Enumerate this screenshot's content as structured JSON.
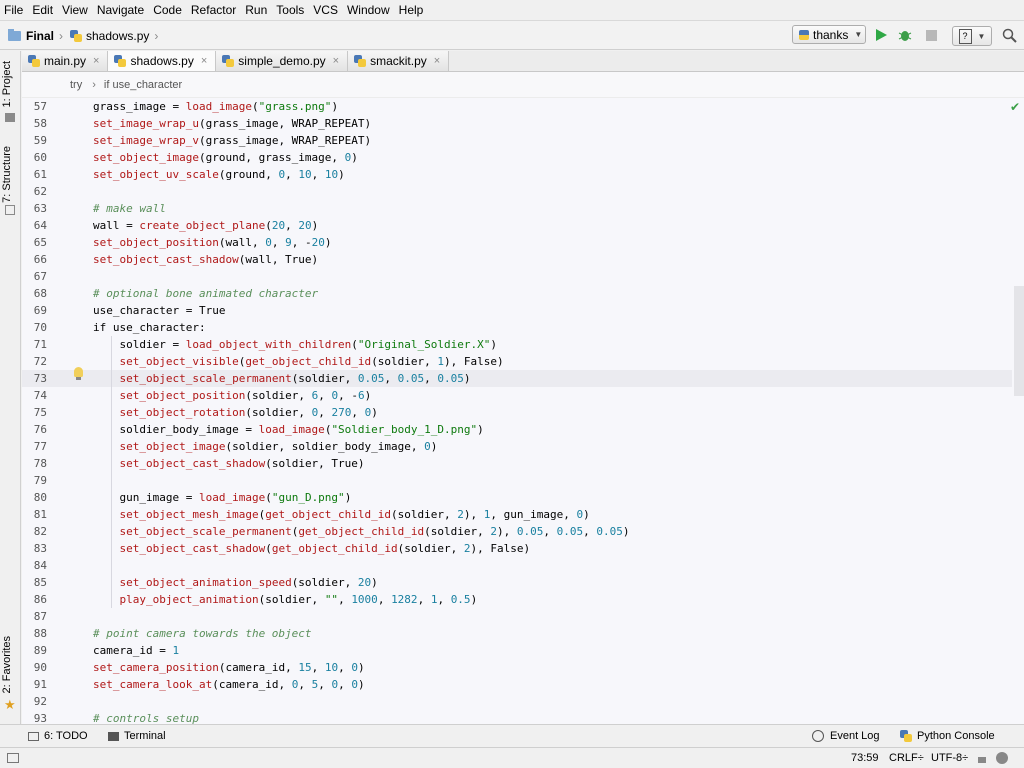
{
  "menu": [
    "File",
    "Edit",
    "View",
    "Navigate",
    "Code",
    "Refactor",
    "Run",
    "Tools",
    "VCS",
    "Window",
    "Help"
  ],
  "nav": {
    "project": "Final",
    "file": "shadows.py"
  },
  "toolbar": {
    "run_config": "thanks"
  },
  "left_tools": {
    "project": "1: Project",
    "structure": "7: Structure",
    "favorites": "2: Favorites"
  },
  "tabs": [
    {
      "label": "main.py"
    },
    {
      "label": "shadows.py"
    },
    {
      "label": "simple_demo.py"
    },
    {
      "label": "smackit.py"
    }
  ],
  "breadcrumb": {
    "a": "try",
    "b": "if use_character"
  },
  "code_lines": [
    {
      "n": "57",
      "text": "grass_image = load_image(\"grass.png\")"
    },
    {
      "n": "58",
      "text": "set_image_wrap_u(grass_image, WRAP_REPEAT)"
    },
    {
      "n": "59",
      "text": "set_image_wrap_v(grass_image, WRAP_REPEAT)"
    },
    {
      "n": "60",
      "text": "set_object_image(ground, grass_image, 0)"
    },
    {
      "n": "61",
      "text": "set_object_uv_scale(ground, 0, 10, 10)"
    },
    {
      "n": "62",
      "text": ""
    },
    {
      "n": "63",
      "text": "# make wall"
    },
    {
      "n": "64",
      "text": "wall = create_object_plane(20, 20)"
    },
    {
      "n": "65",
      "text": "set_object_position(wall, 0, 9, -20)"
    },
    {
      "n": "66",
      "text": "set_object_cast_shadow(wall, True)"
    },
    {
      "n": "67",
      "text": ""
    },
    {
      "n": "68",
      "text": "# optional bone animated character"
    },
    {
      "n": "69",
      "text": "use_character = True"
    },
    {
      "n": "70",
      "text": "if use_character:"
    },
    {
      "n": "71",
      "text": "    soldier = load_object_with_children(\"Original_Soldier.X\")"
    },
    {
      "n": "72",
      "text": "    set_object_visible(get_object_child_id(soldier, 1), False)"
    },
    {
      "n": "73",
      "text": "    set_object_scale_permanent(soldier, 0.05, 0.05, 0.05)"
    },
    {
      "n": "74",
      "text": "    set_object_position(soldier, 6, 0, -6)"
    },
    {
      "n": "75",
      "text": "    set_object_rotation(soldier, 0, 270, 0)"
    },
    {
      "n": "76",
      "text": "    soldier_body_image = load_image(\"Soldier_body_1_D.png\")"
    },
    {
      "n": "77",
      "text": "    set_object_image(soldier, soldier_body_image, 0)"
    },
    {
      "n": "78",
      "text": "    set_object_cast_shadow(soldier, True)"
    },
    {
      "n": "79",
      "text": ""
    },
    {
      "n": "80",
      "text": "    gun_image = load_image(\"gun_D.png\")"
    },
    {
      "n": "81",
      "text": "    set_object_mesh_image(get_object_child_id(soldier, 2), 1, gun_image, 0)"
    },
    {
      "n": "82",
      "text": "    set_object_scale_permanent(get_object_child_id(soldier, 2), 0.05, 0.05, 0.05)"
    },
    {
      "n": "83",
      "text": "    set_object_cast_shadow(get_object_child_id(soldier, 2), False)"
    },
    {
      "n": "84",
      "text": ""
    },
    {
      "n": "85",
      "text": "    set_object_animation_speed(soldier, 20)"
    },
    {
      "n": "86",
      "text": "    play_object_animation(soldier, \"\", 1000, 1282, 1, 0.5)"
    },
    {
      "n": "87",
      "text": ""
    },
    {
      "n": "88",
      "text": "# point camera towards the object"
    },
    {
      "n": "89",
      "text": "camera_id = 1"
    },
    {
      "n": "90",
      "text": "set_camera_position(camera_id, 15, 10, 0)"
    },
    {
      "n": "91",
      "text": "set_camera_look_at(camera_id, 0, 5, 0, 0)"
    },
    {
      "n": "92",
      "text": ""
    },
    {
      "n": "93",
      "text": "# controls setup"
    }
  ],
  "current_line": "73",
  "bottom_tools": {
    "todo": "6: TODO",
    "terminal": "Terminal",
    "event_log": "Event Log",
    "python_console": "Python Console"
  },
  "status": {
    "position": "73:59",
    "line_sep": "CRLF÷",
    "encoding": "UTF-8÷"
  }
}
